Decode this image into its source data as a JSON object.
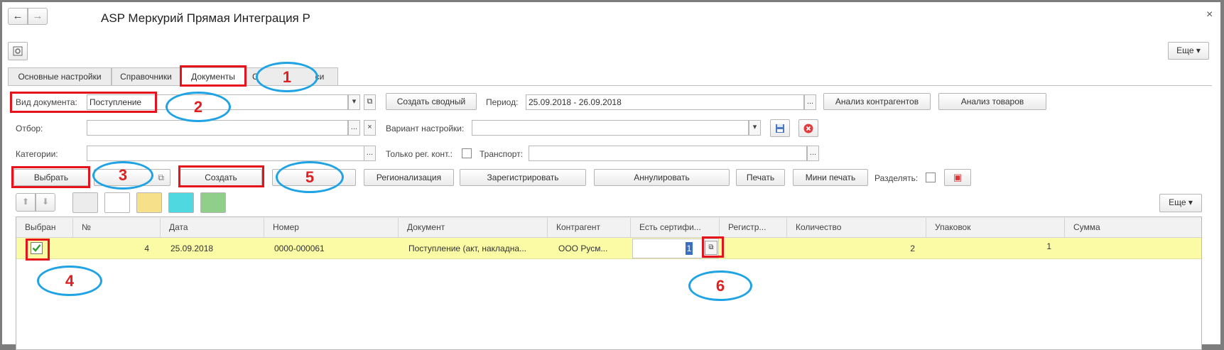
{
  "window": {
    "title": "ASP Меркурий Прямая Интеграция Р",
    "close_glyph": "×",
    "more_label": "Еще"
  },
  "tabs": [
    {
      "label": "Основные настройки"
    },
    {
      "label": "Справочники"
    },
    {
      "label": "Документы"
    },
    {
      "label": "С"
    },
    {
      "label": "си"
    }
  ],
  "form": {
    "doc_type_label": "Вид документа:",
    "doc_type_value": "Поступление",
    "create_summary_label": "Создать сводный",
    "period_label": "Период:",
    "period_value": "25.09.2018 - 26.09.2018",
    "analyze_contractors_label": "Анализ контрагентов",
    "analyze_goods_label": "Анализ товаров",
    "filter_label": "Отбор:",
    "setting_variant_label": "Вариант настройки:",
    "categories_label": "Категории:",
    "only_reg_label": "Только рег. конт.:",
    "transport_label": "Транспорт:",
    "ellipsis": "...",
    "clear_glyph": "×"
  },
  "toolbar": {
    "select_label": "Выбрать",
    "create_label": "Создать",
    "regionalization_label": "Регионализация",
    "register_label": "Зарегистрировать",
    "cancel_label": "Аннулировать",
    "print_label": "Печать",
    "mini_print_label": "Мини печать",
    "split_label": "Разделять:",
    "more_label": "Еще"
  },
  "swatch_colors": [
    "#ececec",
    "#ffffff",
    "#f7e08a",
    "#4fd8e0",
    "#8fcf8a"
  ],
  "table": {
    "columns": [
      "Выбран",
      "№",
      "Дата",
      "Номер",
      "Документ",
      "Контрагент",
      "Есть сертифи...",
      "Регистр...",
      "Количество",
      "Упаковок",
      "Сумма"
    ],
    "rows": [
      {
        "selected": true,
        "num": "4",
        "date": "25.09.2018",
        "number": "0000-000061",
        "document": "Поступление (акт, накладна...",
        "contractor": "ООО Русм...",
        "has_cert": "1",
        "registered": "",
        "quantity": "2",
        "packages": "1",
        "sum": ""
      }
    ]
  },
  "annotations": [
    "1",
    "2",
    "3",
    "4",
    "5",
    "6"
  ],
  "colors": {
    "highlight_row": "#fbfba6",
    "annotation_box": "#e8121c",
    "annotation_ellipse": "#1fa3e4",
    "annotation_number": "#e02020"
  }
}
